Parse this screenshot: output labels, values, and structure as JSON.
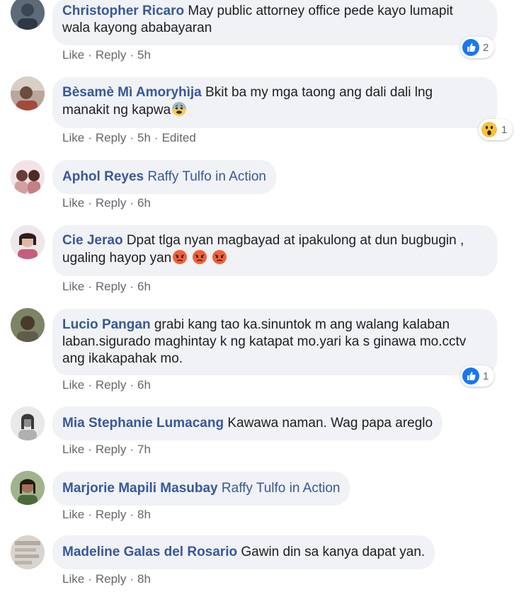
{
  "comments": [
    {
      "author": "Christopher Ricaro",
      "text_line1": "May public attorney office pede kayo lumapit",
      "text_line2": "wala kayong ababayaran",
      "like": "Like",
      "reply": "Reply",
      "time": "5h",
      "reaction_count": "2",
      "reaction_icon": "like-icon"
    },
    {
      "author": "Bèsamè Mì Amoryhìja",
      "text_line1": "Bkit ba my mga taong ang dali dali lng",
      "text_line2": "manakit ng kapwa",
      "like": "Like",
      "reply": "Reply",
      "time": "5h",
      "edited": "Edited",
      "reaction_count": "1",
      "reaction_icon": "wow-icon",
      "inline_emoji": "fearful-face-emoji"
    },
    {
      "author": "Aphol Reyes",
      "tag": "Raffy Tulfo in Action",
      "like": "Like",
      "reply": "Reply",
      "time": "6h"
    },
    {
      "author": "Cie Jerao",
      "text_line1": "Dpat tlga nyan magbayad at ipakulong at dun bugbugin ,",
      "text_line2": "ugaling hayop yan",
      "inline_emoji": "angry-face-emoji",
      "like": "Like",
      "reply": "Reply",
      "time": "6h"
    },
    {
      "author": "Lucio Pangan",
      "text_line1": "grabi kang tao ka.sinuntok m ang walang kalaban",
      "text_line2": "laban.sigurado maghintay k ng katapat mo.yari ka s ginawa mo.cctv",
      "text_line3": "ang ikakapahak mo.",
      "like": "Like",
      "reply": "Reply",
      "time": "6h",
      "reaction_count": "1",
      "reaction_icon": "like-icon"
    },
    {
      "author": "Mia Stephanie Lumacang",
      "text_line1": "Kawawa naman. Wag papa areglo",
      "like": "Like",
      "reply": "Reply",
      "time": "7h"
    },
    {
      "author": "Marjorie Mapili Masubay",
      "tag": "Raffy Tulfo in Action",
      "like": "Like",
      "reply": "Reply",
      "time": "8h"
    },
    {
      "author": "Madeline Galas del Rosario",
      "text_line1": "Gawin din sa kanya dapat yan.",
      "like": "Like",
      "reply": "Reply",
      "time": "8h"
    }
  ],
  "colors": {
    "name": "#385898",
    "bubble": "#f0f2f5",
    "meta": "#65676b",
    "like_blue": "#1877f2"
  }
}
